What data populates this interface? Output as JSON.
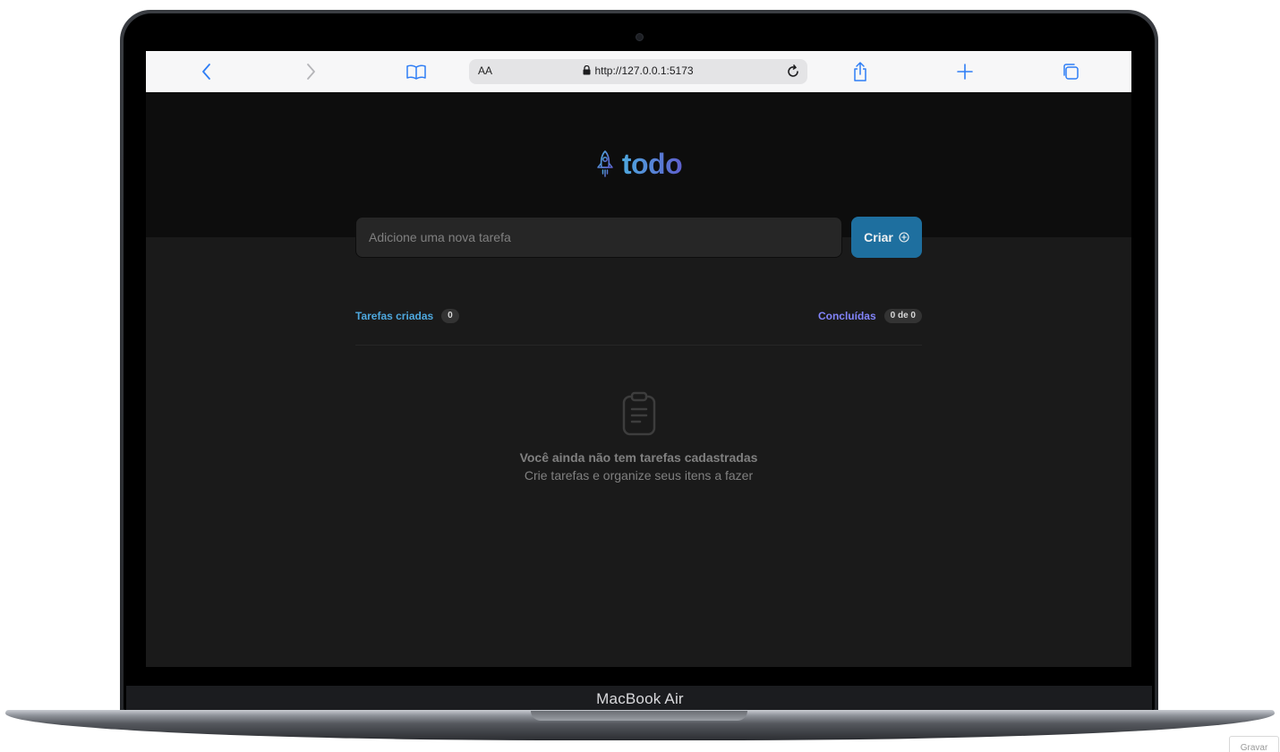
{
  "device": {
    "label": "MacBook Air"
  },
  "browser": {
    "text_size_label": "AA",
    "url": "http://127.0.0.1:5173",
    "icons": [
      "back-icon",
      "forward-icon",
      "bookmarks-icon",
      "lock-icon",
      "reload-icon",
      "share-icon",
      "new-tab-icon",
      "tabs-icon"
    ]
  },
  "app": {
    "logo_icon": "rocket-icon",
    "logo_text": "todo",
    "new_task": {
      "placeholder": "Adicione uma nova tarefa",
      "value": ""
    },
    "create_button": {
      "label": "Criar",
      "icon": "plus-circle-icon"
    },
    "counters": {
      "created_label": "Tarefas criadas",
      "created_count": "0",
      "done_label": "Concluídas",
      "done_count": "0 de 0"
    },
    "empty_state": {
      "icon": "clipboard-icon",
      "title": "Você ainda não tem tarefas cadastradas",
      "subtitle": "Crie tarefas e organize seus itens a fazer"
    },
    "colors": {
      "blue": "#4ea8de",
      "purple": "#8284fa",
      "button": "#1e6f9f",
      "header_bg": "#0d0d0d",
      "body_bg": "#1a1a1a"
    }
  },
  "overlay": {
    "record_label": "Gravar"
  }
}
